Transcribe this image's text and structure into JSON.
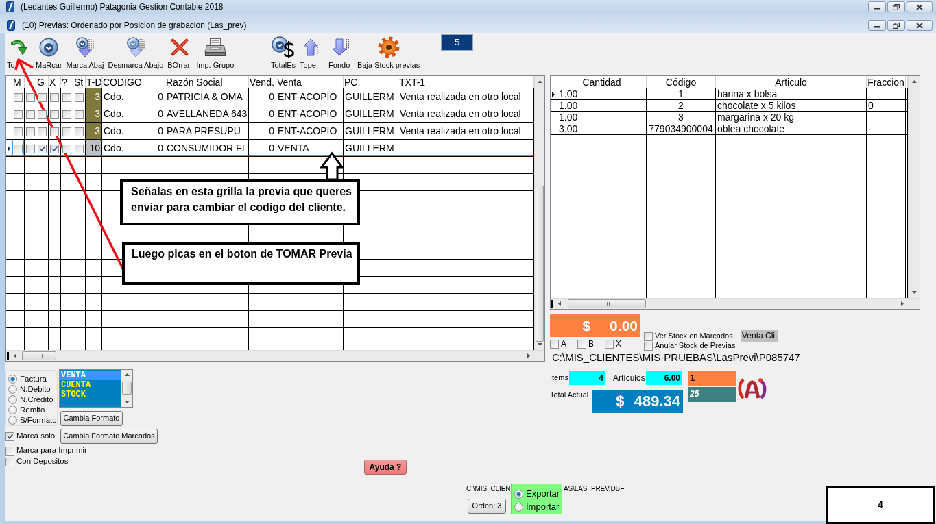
{
  "app_window": {
    "title": "(Ledantes Guillermo) Patagonia Gestion Contable 2018"
  },
  "window": {
    "title": "(10) Previas: Ordenado por Posicion de grabacion (Las_prev)"
  },
  "toolbar": {
    "groups": [
      [
        {
          "kind": "take",
          "label": "To"
        },
        {
          "kind": "mark",
          "label": "MaRcar"
        },
        {
          "kind": "mark_down",
          "label": "Marca Abaj"
        },
        {
          "kind": "unmark_down",
          "label": "Desmarca Abajo"
        },
        {
          "kind": "delete",
          "label": "BOrrar"
        },
        {
          "kind": "print",
          "label": "Imp. Grupo"
        }
      ],
      [
        {
          "kind": "totals",
          "label": "TotalEs"
        },
        {
          "kind": "top",
          "label": "Tope"
        },
        {
          "kind": "bottom",
          "label": "Fondo"
        },
        {
          "kind": "stock",
          "label": "Baja Stock previas"
        }
      ]
    ],
    "counter": "5"
  },
  "left_grid": {
    "columns": [
      {
        "kind": "check",
        "label": "M"
      },
      {
        "kind": "check"
      },
      {
        "kind": "check",
        "label": "G"
      },
      {
        "kind": "check",
        "label": "X"
      },
      {
        "kind": "check",
        "label": "?"
      },
      {
        "kind": "check",
        "label": "St"
      },
      {
        "kind": "tag",
        "label": "T-D"
      },
      {
        "kind": "pair",
        "label": "CODIGO"
      },
      {
        "kind": "text",
        "label": "Razón Social"
      },
      {
        "kind": "number",
        "label": "Vend."
      },
      {
        "kind": "text",
        "label": "Venta"
      },
      {
        "kind": "text",
        "label": "PC."
      },
      {
        "kind": "text",
        "label": "TXT-1"
      }
    ],
    "rows": [
      {
        "selected": false,
        "cells": [
          {
            "checked": false
          },
          {
            "checked": false
          },
          {
            "checked": false
          },
          {
            "checked": false
          },
          {
            "checked": false
          },
          {
            "checked": false
          },
          {
            "text": "3",
            "color": "#807b3c"
          },
          {
            "text": "Cdo.",
            "value": "0"
          },
          "PATRICIA & OMA",
          "0",
          "ENT-ACOPIO",
          "GUILLERM",
          "Venta realizada en otro local"
        ]
      },
      {
        "selected": false,
        "cells": [
          {
            "checked": false
          },
          {
            "checked": false
          },
          {
            "checked": false
          },
          {
            "checked": false
          },
          {
            "checked": false
          },
          {
            "checked": false
          },
          {
            "text": "3",
            "color": "#807b3c"
          },
          {
            "text": "Cdo.",
            "value": "0"
          },
          "AVELLANEDA 643",
          "0",
          "ENT-ACOPIO",
          "GUILLERM",
          "Venta realizada en otro local"
        ]
      },
      {
        "selected": false,
        "cells": [
          {
            "checked": false
          },
          {
            "checked": false
          },
          {
            "checked": false
          },
          {
            "checked": false
          },
          {
            "checked": false
          },
          {
            "checked": false
          },
          {
            "text": "3",
            "color": "#807b3c"
          },
          {
            "text": "Cdo.",
            "value": "0"
          },
          "PARA PRESUPU",
          "0",
          "ENT-ACOPIO",
          "GUILLERM",
          "Venta realizada en otro local"
        ]
      },
      {
        "selected": true,
        "cells": [
          {
            "checked": false
          },
          {
            "checked": false
          },
          {
            "checked": true
          },
          {
            "checked": true
          },
          {
            "checked": false
          },
          {
            "checked": false
          },
          {
            "text": "10",
            "color": "#c0c0c0"
          },
          {
            "text": "Cdo.",
            "value": "0"
          },
          "CONSUMIDOR FI",
          "0",
          "VENTA",
          "GUILLERM"
        ]
      }
    ]
  },
  "right_grid": {
    "columns": [
      {
        "kind": "text",
        "label": "Cantidad"
      },
      {
        "kind": "code",
        "label": "Código"
      },
      {
        "kind": "text",
        "label": "Articulo"
      },
      {
        "kind": "text",
        "label": "Fraccion"
      }
    ],
    "rows": [
      {
        "selected": true,
        "cells": [
          "1.00",
          "1",
          "harina x bolsa"
        ]
      },
      {
        "selected": false,
        "cells": [
          "1.00",
          "2",
          "chocolate x 5 kilos",
          "0"
        ]
      },
      {
        "selected": false,
        "cells": [
          "1.00",
          "3",
          "margarina x 20 kg"
        ]
      },
      {
        "selected": false,
        "cells": [
          "3.00",
          "779034900004",
          "oblea chocolate"
        ]
      }
    ]
  },
  "summary": {
    "amount": "$ 0.00",
    "flags": [
      {
        "label": "A",
        "checked": false
      },
      {
        "label": "B",
        "checked": false
      },
      {
        "label": "X",
        "checked": false
      }
    ],
    "stock_options": [
      {
        "label": "Ver Stock en Marcados",
        "checked": false
      },
      {
        "label": "Anular Stock de Previas",
        "checked": false
      }
    ],
    "client_sale": "Venta Cli.",
    "file_path": "C:\\MIS_CLIENTES\\MIS-PRUEBAS\\LasPrevi\\P085747",
    "items_label": "Items",
    "items": "4",
    "articles_label": "Artículos",
    "articles": "6.00",
    "field_1": "1",
    "field_2": "25",
    "total_label": "Total Actual",
    "total": "$ 489.34"
  },
  "format": {
    "options": [
      {
        "label": "Factura",
        "selected": true
      },
      {
        "label": "N.Debito",
        "selected": false
      },
      {
        "label": "N.Credito",
        "selected": false
      },
      {
        "label": "Remito",
        "selected": false
      },
      {
        "label": "S/Formato",
        "selected": false
      }
    ],
    "list": [
      {
        "label": "VENTA",
        "selected": true
      },
      {
        "label": "CUENTA",
        "selected": false
      },
      {
        "label": "STOCK",
        "selected": false
      }
    ],
    "change_button": "Cambia Formato",
    "change_marked_button": "Cambia Formato Marcados"
  },
  "options": [
    {
      "label": "Marca solo",
      "checked": true
    },
    {
      "label": "Marca para Imprimir",
      "checked": false
    },
    {
      "label": "Con Depositos",
      "checked": false
    }
  ],
  "help_button": "Ayuda ?",
  "footer": {
    "path_start": "C:\\MIS_CLIEN",
    "path_end": "AS\\LAS_PREV.DBF",
    "transfer": [
      {
        "label": "Exportar",
        "selected": true
      },
      {
        "label": "Importar",
        "selected": false
      }
    ],
    "order_button": "Orden: 3"
  },
  "annotations": {
    "notes": [
      "Señalas en esta grilla la previa que queres enviar para cambiar el codigo del cliente.",
      "Luego picas en el boton de TOMAR Previa"
    ],
    "step": "4"
  }
}
